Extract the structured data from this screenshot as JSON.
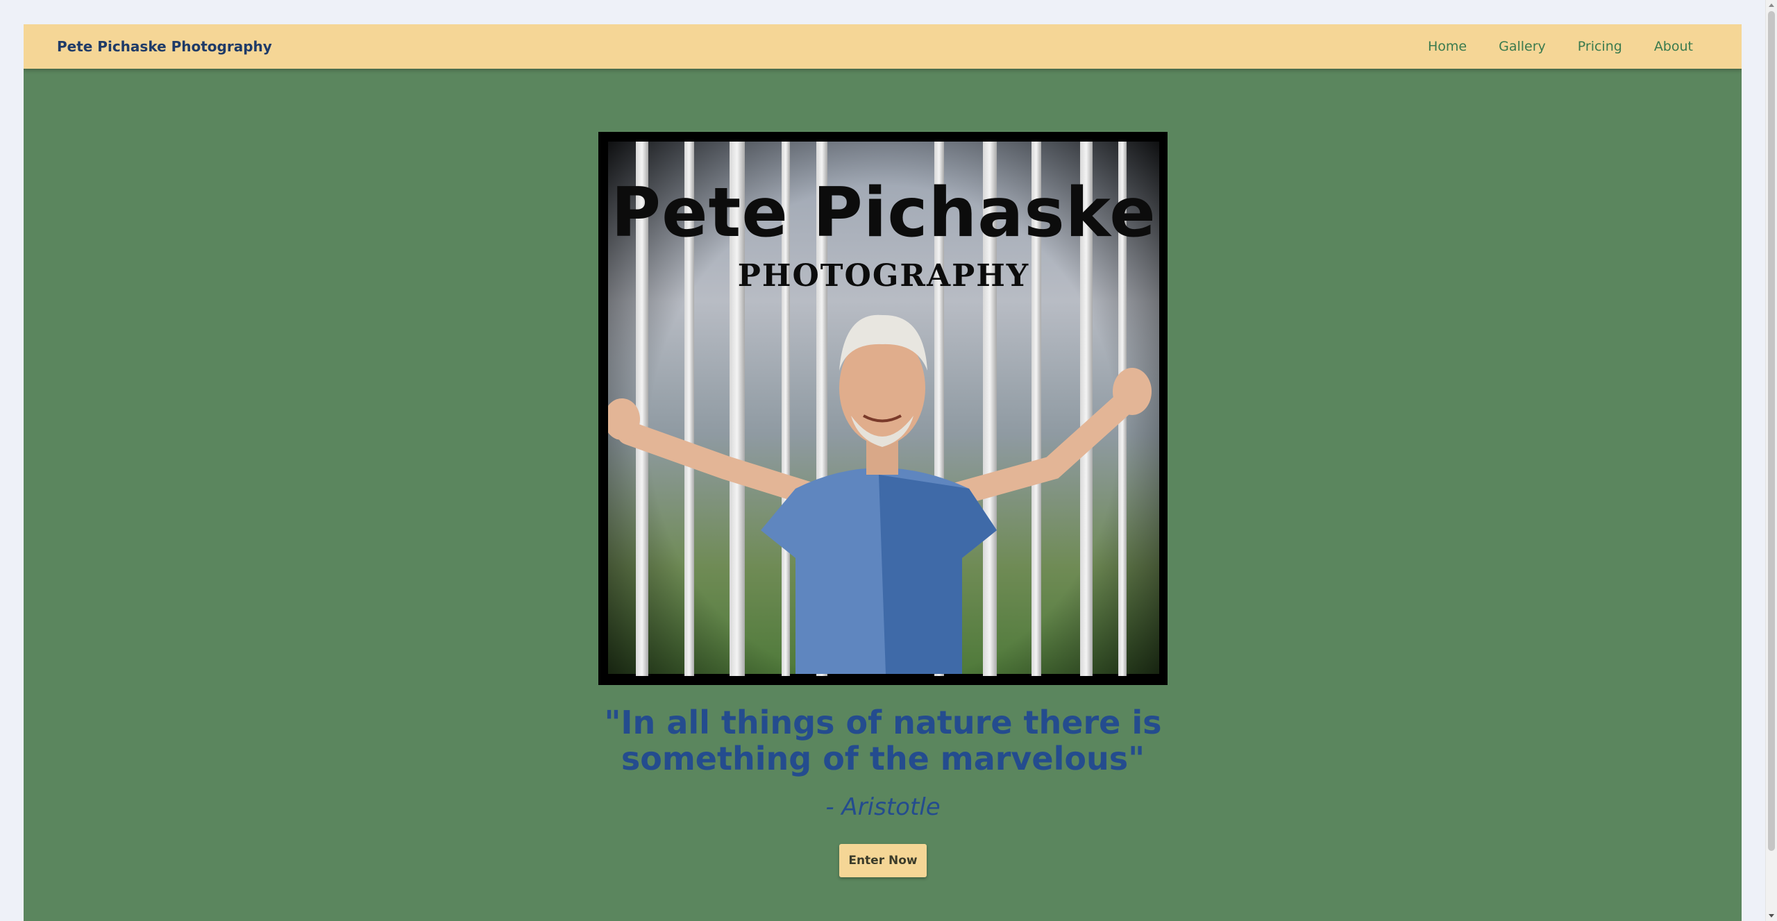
{
  "navbar": {
    "brand": "Pete Pichaske Photography",
    "links": [
      "Home",
      "Gallery",
      "Pricing",
      "About"
    ]
  },
  "hero_image": {
    "title": "Pete Pichaske",
    "subtitle": "PHOTOGRAPHY"
  },
  "quote": {
    "text": "\"In all things of nature there is something of the marvelous\"",
    "author": "- Aristotle"
  },
  "cta": {
    "label": "Enter Now"
  },
  "colors": {
    "page_background": "#5b865e",
    "navbar_background": "#f5d696",
    "brand_text": "#1f3b68",
    "nav_link": "#3a7a4e",
    "quote_text": "#244c8e",
    "button_background": "#f5d696"
  }
}
